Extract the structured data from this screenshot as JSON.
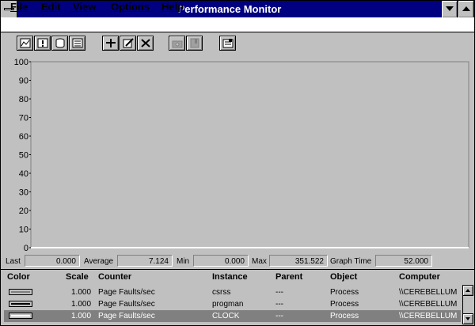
{
  "window": {
    "title": "Performance Monitor"
  },
  "menu": [
    "File",
    "Edit",
    "View",
    "Options",
    "Help"
  ],
  "toolbar": {
    "buttons": [
      "view-chart",
      "view-alert",
      "view-log",
      "view-report",
      "add-counter",
      "edit-counter",
      "delete-counter",
      "update-now",
      "bookmark",
      "options"
    ]
  },
  "value_bar": {
    "last_label": "Last",
    "last_value": "0.000",
    "average_label": "Average",
    "average_value": "7.124",
    "min_label": "Min",
    "min_value": "0.000",
    "max_label": "Max",
    "max_value": "351.522",
    "graph_time_label": "Graph Time",
    "graph_time_value": "52.000"
  },
  "legend": {
    "headers": {
      "color": "Color",
      "scale": "Scale",
      "counter": "Counter",
      "instance": "Instance",
      "parent": "Parent",
      "object": "Object",
      "computer": "Computer"
    },
    "rows": [
      {
        "color": "#c0c0c0",
        "scale": "1.000",
        "counter": "Page Faults/sec",
        "instance": "csrss",
        "parent": "---",
        "object": "Process",
        "computer": "\\\\CEREBELLUM"
      },
      {
        "color": "#000000",
        "scale": "1.000",
        "counter": "Page Faults/sec",
        "instance": "progman",
        "parent": "---",
        "object": "Process",
        "computer": "\\\\CEREBELLUM"
      },
      {
        "color": "#ffffff",
        "scale": "1.000",
        "counter": "Page Faults/sec",
        "instance": "CLOCK",
        "parent": "---",
        "object": "Process",
        "computer": "\\\\CEREBELLUM"
      }
    ],
    "selected_row": 2
  },
  "chart_data": {
    "type": "line",
    "ylim": [
      0,
      100
    ],
    "yticks": [
      "100",
      "90",
      "80",
      "70",
      "60",
      "50",
      "40",
      "30",
      "20",
      "10",
      "0"
    ],
    "x": [
      0,
      1,
      2,
      3,
      4,
      5,
      6,
      7,
      8,
      9,
      10,
      11,
      12,
      13,
      14,
      15,
      16,
      17,
      18,
      19,
      20,
      21,
      22,
      23,
      24,
      25,
      26,
      27,
      28,
      29,
      30,
      31,
      32,
      33,
      34,
      35,
      36,
      37,
      38,
      39,
      40,
      41,
      42,
      43,
      44,
      45,
      46,
      47,
      48,
      49,
      50,
      51,
      52,
      53,
      54,
      55,
      56,
      57,
      58,
      59,
      60,
      61,
      62,
      63,
      64,
      65,
      66,
      67,
      68,
      69,
      70,
      71,
      72,
      73,
      74,
      75,
      76,
      77,
      78,
      79,
      80,
      81,
      82,
      83,
      84,
      85,
      86,
      87,
      88,
      89,
      90,
      91,
      92,
      93,
      94,
      95,
      96,
      97,
      98,
      99
    ],
    "series": [
      {
        "color": "#c0c0c0",
        "values": [
          0,
          0,
          0,
          0,
          0,
          0,
          0,
          0,
          0,
          0,
          0,
          0,
          0,
          0,
          0,
          0,
          0,
          0,
          0,
          0,
          0,
          0,
          0,
          0,
          0,
          0,
          0,
          0,
          0,
          0,
          0,
          0,
          0,
          0,
          0,
          0,
          0,
          0,
          0,
          0,
          0,
          0,
          0,
          0,
          0,
          0,
          0,
          0,
          0,
          0,
          0,
          0,
          0,
          0,
          0,
          0,
          0,
          0,
          0,
          0,
          0,
          0,
          0,
          0,
          0,
          0,
          0,
          0,
          0,
          0,
          0,
          0,
          0,
          0,
          0,
          0,
          0,
          0,
          0,
          0,
          0,
          0,
          0,
          0,
          0,
          0,
          0,
          0,
          0,
          0,
          0,
          0,
          0,
          0,
          0,
          0,
          0,
          0,
          0,
          0
        ]
      },
      {
        "color": "#000000",
        "values": [
          0,
          0,
          0,
          0,
          0,
          0,
          0,
          0,
          0,
          0,
          0,
          0,
          0,
          0,
          0,
          0,
          0,
          0,
          0,
          0,
          0,
          0,
          0,
          0,
          0,
          0,
          0,
          0,
          0,
          0,
          0,
          0,
          0,
          0,
          0,
          0,
          0,
          0,
          0,
          0,
          0,
          0,
          0,
          0,
          0,
          0,
          0,
          0,
          0,
          0,
          0,
          0,
          0,
          0,
          0,
          0,
          0,
          0,
          0,
          0,
          0,
          0,
          0,
          0,
          0,
          0,
          0,
          0,
          0,
          0,
          0,
          0,
          0,
          0,
          0,
          0,
          0,
          0,
          0,
          0,
          0,
          0,
          0,
          0,
          0,
          0,
          0,
          0,
          0,
          0,
          0,
          0,
          0,
          0,
          0,
          0,
          0,
          0,
          0,
          0
        ]
      },
      {
        "color": "#ffffff",
        "values": [
          0,
          0,
          0,
          0,
          0,
          0,
          0,
          0,
          0,
          0,
          0,
          0,
          0,
          0,
          0,
          0,
          0,
          0,
          0,
          0,
          0,
          0,
          0,
          0,
          0,
          0,
          0,
          0,
          0,
          0,
          0,
          0,
          0,
          0,
          0,
          0,
          0,
          0,
          0,
          0,
          0,
          0,
          0,
          0,
          0,
          0,
          0,
          0,
          0,
          0,
          0,
          0,
          0,
          0,
          0,
          0,
          0,
          0,
          0,
          0,
          0,
          0,
          0,
          0,
          0,
          0,
          0,
          0,
          0,
          0,
          0,
          0,
          0,
          0,
          0,
          0,
          0,
          0,
          0,
          0,
          0,
          0,
          0,
          0,
          0,
          0,
          0,
          0,
          0,
          0,
          0,
          0,
          0,
          0,
          0,
          0,
          0,
          0,
          0,
          0
        ]
      }
    ]
  }
}
